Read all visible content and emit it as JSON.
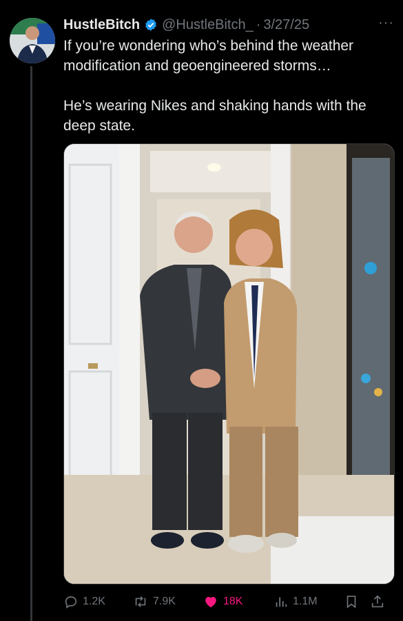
{
  "tweet": {
    "display_name": "HustleBitch",
    "handle": "@HustleBitch_",
    "separator": "·",
    "date": "3/27/25",
    "more_label": "···",
    "text_lines": [
      "If you’re wondering who’s behind the weather modification and geoengineered storms…",
      "He’s wearing Nikes and shaking hands with the deep state."
    ]
  },
  "actions": {
    "replies": "1.2K",
    "retweets": "7.9K",
    "likes": "18K",
    "views": "1.1M"
  },
  "icons": {
    "verified": "verified-badge-icon",
    "reply": "reply-icon",
    "retweet": "retweet-icon",
    "like": "heart-icon",
    "views": "views-icon",
    "bookmark": "bookmark-icon",
    "share": "share-icon"
  },
  "colors": {
    "background": "#000000",
    "text": "#e7e9ea",
    "muted": "#71767b",
    "verified": "#1d9bf0",
    "like": "#f91880"
  }
}
